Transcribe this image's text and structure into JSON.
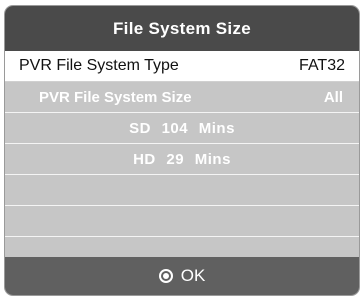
{
  "dialog": {
    "title": "File System Size",
    "rows": [
      {
        "label": "PVR File System Type",
        "value": "FAT32"
      },
      {
        "label": "PVR File System Size",
        "value": "All"
      },
      {
        "label": "SD  104  Mins",
        "value": ""
      },
      {
        "label": "HD  29  Mins",
        "value": ""
      }
    ],
    "footer": {
      "icon": "ok-button-icon",
      "label": "OK"
    }
  },
  "colors": {
    "title_bg": "#4a4a4a",
    "selected_row_bg": "#ffffff",
    "row_bg": "#c6c6c6",
    "footer_bg": "#606060"
  }
}
